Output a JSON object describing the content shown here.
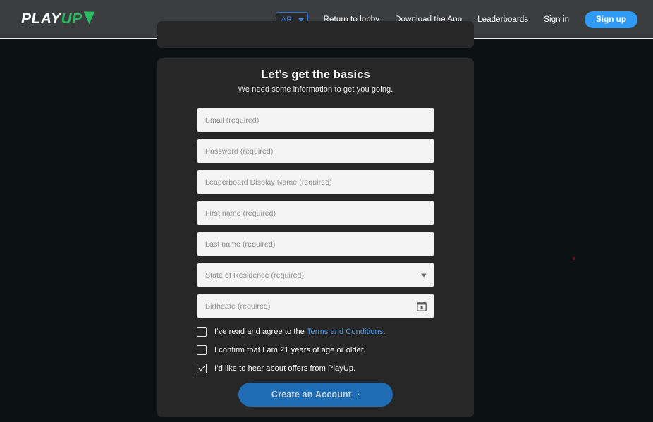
{
  "header": {
    "logo": {
      "part1": "PLAY",
      "part2": "UP",
      "mark_icon": "playup-arrow-icon",
      "color_primary": "#ffffff",
      "color_accent": "#2aba62"
    },
    "language_select": {
      "value": "AR",
      "icon": "chevron-down-icon",
      "border_color": "#2f6fd0",
      "text_color": "#3a82e8"
    },
    "links": [
      {
        "label": "Return to lobby"
      },
      {
        "label": "Download the App"
      },
      {
        "label": "Leaderboards"
      },
      {
        "label": "Sign in"
      }
    ],
    "signup_button": {
      "label": "Sign up",
      "color": "#2f9bf5"
    }
  },
  "card": {
    "title": "Let’s get the basics",
    "subtitle": "We need some information to get you going.",
    "background": "#272727",
    "fields": [
      {
        "name": "email",
        "placeholder": "Email (required)",
        "value": "",
        "icon": null
      },
      {
        "name": "password",
        "placeholder": "Password (required)",
        "value": "",
        "icon": null
      },
      {
        "name": "leaderboard-display-name",
        "placeholder": "Leaderboard Display Name (required)",
        "value": "",
        "icon": null
      },
      {
        "name": "first-name",
        "placeholder": "First name (required)",
        "value": "",
        "icon": null
      },
      {
        "name": "last-name",
        "placeholder": "Last name (required)",
        "value": "",
        "icon": null
      },
      {
        "name": "state-of-residence",
        "placeholder": "State of Residence (required)",
        "value": "",
        "icon": "chevron-down-icon"
      },
      {
        "name": "birthdate",
        "placeholder": "Birthdate (required)",
        "value": "",
        "icon": "calendar-icon"
      }
    ],
    "checkboxes": [
      {
        "name": "terms",
        "checked": false,
        "text_before": "I’ve read and agree to the ",
        "link_text": "Terms and Conditions",
        "text_after": "."
      },
      {
        "name": "age-confirm",
        "checked": false,
        "text_before": "I confirm that I am 21 years of age or older.",
        "link_text": "",
        "text_after": ""
      },
      {
        "name": "marketing-offers",
        "checked": true,
        "text_before": "I’d like to hear about offers from PlayUp.",
        "link_text": "",
        "text_after": ""
      }
    ],
    "submit": {
      "label": "Create an Account",
      "chevron": "›",
      "color": "#1d6cb4"
    }
  },
  "page": {
    "background": "#0c1114",
    "link_color": "#4a9ae8"
  }
}
